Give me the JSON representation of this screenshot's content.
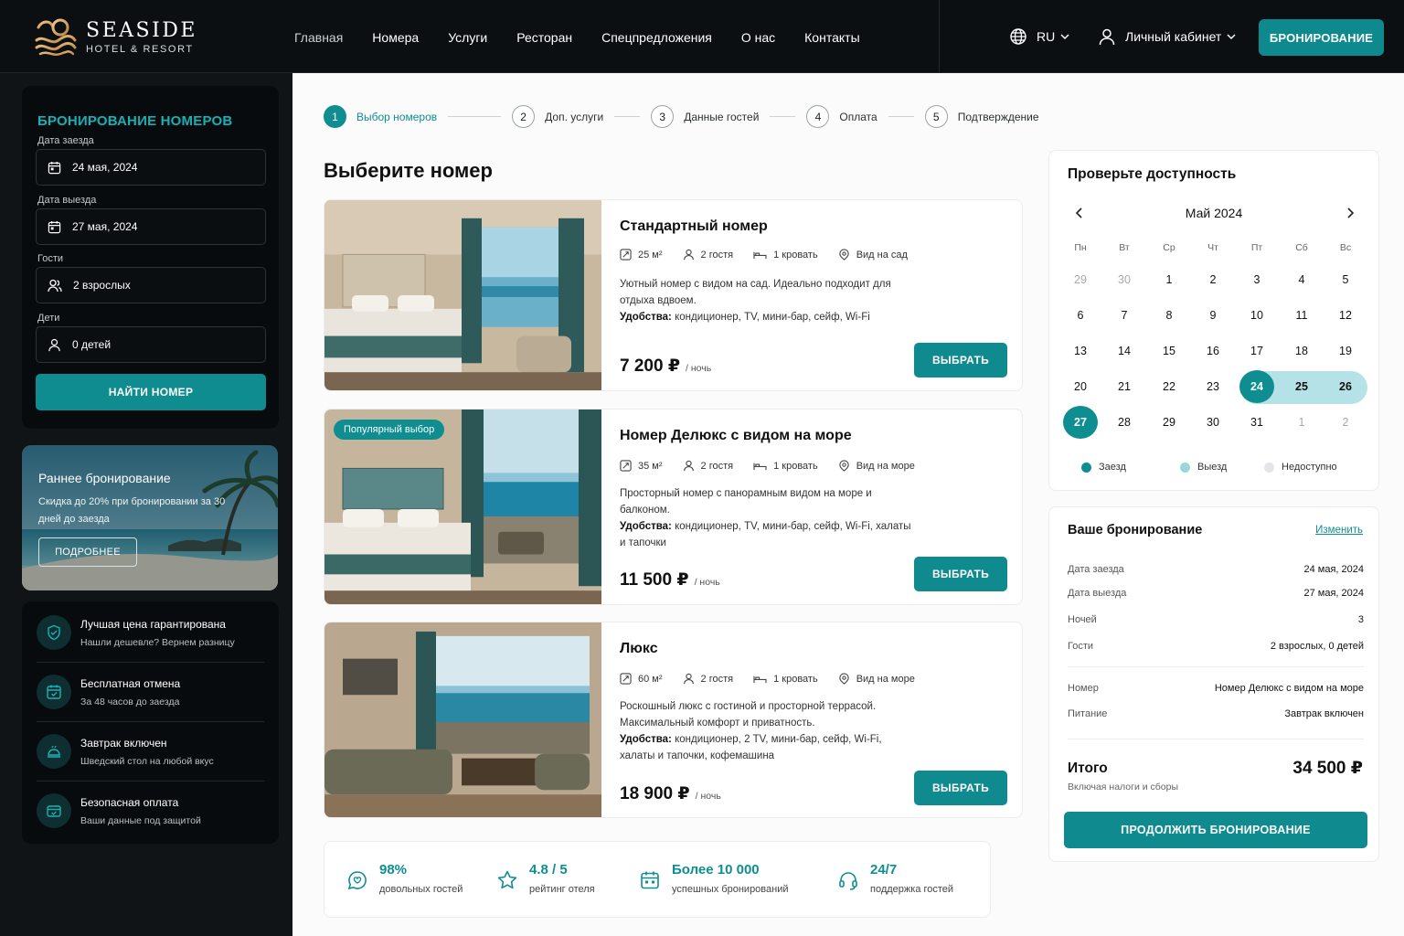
{
  "brand": {
    "name": "SEASIDE",
    "sub": "HOTEL & RESORT"
  },
  "nav": [
    "Главная",
    "Номера",
    "Услуги",
    "Ресторан",
    "Спецпредложения",
    "О нас",
    "Контакты"
  ],
  "header": {
    "lang": "RU",
    "account": "Личный кабинет",
    "book": "БРОНИРОВАНИЕ"
  },
  "booking_form": {
    "title": "БРОНИРОВАНИЕ НОМЕРОВ",
    "checkin_label": "Дата заезда",
    "checkin": "24 мая, 2024",
    "checkout_label": "Дата выезда",
    "checkout": "27 мая, 2024",
    "guests_label": "Гости",
    "guests": "2 взрослых",
    "children_label": "Дети",
    "children": "0 детей",
    "find": "НАЙТИ НОМЕР"
  },
  "promo": {
    "title": "Раннее бронирование",
    "text": "Скидка до 20% при бронировании за 30 дней до заезда",
    "button": "ПОДРОБНЕЕ"
  },
  "features": [
    {
      "title": "Лучшая цена гарантирована",
      "sub": "Нашли дешевле? Вернем разницу",
      "icon": "shield-check-icon"
    },
    {
      "title": "Бесплатная отмена",
      "sub": "За 48 часов до заезда",
      "icon": "calendar-check-icon"
    },
    {
      "title": "Завтрак включен",
      "sub": "Шведский стол на любой вкус",
      "icon": "breakfast-icon"
    },
    {
      "title": "Безопасная оплата",
      "sub": "Ваши данные под защитой",
      "icon": "secure-wallet-icon"
    }
  ],
  "steps": [
    {
      "n": "1",
      "label": "Выбор номеров"
    },
    {
      "n": "2",
      "label": "Доп. услуги"
    },
    {
      "n": "3",
      "label": "Данные гостей"
    },
    {
      "n": "4",
      "label": "Оплата"
    },
    {
      "n": "5",
      "label": "Подтверждение"
    }
  ],
  "heading": "Выберите номер",
  "rooms": [
    {
      "name": "Стандартный номер",
      "area": "25 м²",
      "guests": "2 гостя",
      "bed": "1 кровать",
      "view": "Вид на сад",
      "desc": "Уютный номер с видом на сад. Идеально подходит для отдыха вдвоем.",
      "amen_label": "Удобства:",
      "amen": " кондиционер, TV, мини-бар, сейф, Wi-Fi",
      "price": "7 200 ₽",
      "per": "/ ночь",
      "button": "ВЫБРАТЬ",
      "badge": ""
    },
    {
      "name": "Номер Делюкс с видом на море",
      "area": "35 м²",
      "guests": "2 гостя",
      "bed": "1 кровать",
      "view": "Вид на море",
      "desc": "Просторный номер с панорамным видом на море и балконом.",
      "amen_label": "Удобства:",
      "amen": " кондиционер, TV, мини-бар, сейф, Wi-Fi, халаты и тапочки",
      "price": "11 500 ₽",
      "per": "/ ночь",
      "button": "ВЫБРАТЬ",
      "badge": "Популярный выбор"
    },
    {
      "name": "Люкс",
      "area": "60 м²",
      "guests": "2 гостя",
      "bed": "1 кровать",
      "view": "Вид на море",
      "desc": "Роскошный люкс с гостиной и просторной террасой. Максимальный комфорт и приватность.",
      "amen_label": "Удобства:",
      "amen": " кондиционер, 2 TV, мини-бар, сейф, Wi-Fi, халаты и тапочки, кофемашина",
      "price": "18 900 ₽",
      "per": "/ ночь",
      "button": "ВЫБРАТЬ",
      "badge": ""
    }
  ],
  "stats": [
    {
      "value": "98%",
      "label": "довольных гостей"
    },
    {
      "value": "4.8 / 5",
      "label": "рейтинг отеля"
    },
    {
      "value": "Более 10 000",
      "label": "успешных бронирований"
    },
    {
      "value": "24/7",
      "label": "поддержка гостей"
    }
  ],
  "calendar": {
    "title": "Проверьте доступность",
    "month": "Май 2024",
    "weekdays": [
      "Пн",
      "Вт",
      "Ср",
      "Чт",
      "Пт",
      "Сб",
      "Вс"
    ],
    "weeks": [
      [
        "29",
        "30",
        "1",
        "2",
        "3",
        "4",
        "5"
      ],
      [
        "6",
        "7",
        "8",
        "9",
        "10",
        "11",
        "12"
      ],
      [
        "13",
        "14",
        "15",
        "16",
        "17",
        "18",
        "19"
      ],
      [
        "20",
        "21",
        "22",
        "23",
        "24",
        "25",
        "26"
      ],
      [
        "27",
        "28",
        "29",
        "30",
        "31",
        "1",
        "2"
      ]
    ],
    "legend": {
      "checkin": "Заезд",
      "checkout": "Выезд",
      "unavailable": "Недоступно"
    }
  },
  "summary": {
    "title": "Ваше бронирование",
    "edit": "Изменить",
    "rows": [
      {
        "k": "Дата заезда",
        "v": "24 мая, 2024"
      },
      {
        "k": "Дата выезда",
        "v": "27 мая, 2024"
      },
      {
        "k": "Ночей",
        "v": "3"
      },
      {
        "k": "Гости",
        "v": "2 взрослых, 0 детей"
      },
      {
        "k": "Номер",
        "v": "Номер Делюкс с видом на море"
      },
      {
        "k": "Питание",
        "v": "Завтрак включен"
      }
    ],
    "total_label": "Итого",
    "total_sub": "Включая налоги и сборы",
    "total": "34 500 ₽",
    "button": "ПРОДОЛЖИТЬ БРОНИРОВАНИЕ"
  },
  "colors": {
    "accent": "#0f8e92",
    "dark": "#0b0f12",
    "range": "#b5e2e6"
  }
}
